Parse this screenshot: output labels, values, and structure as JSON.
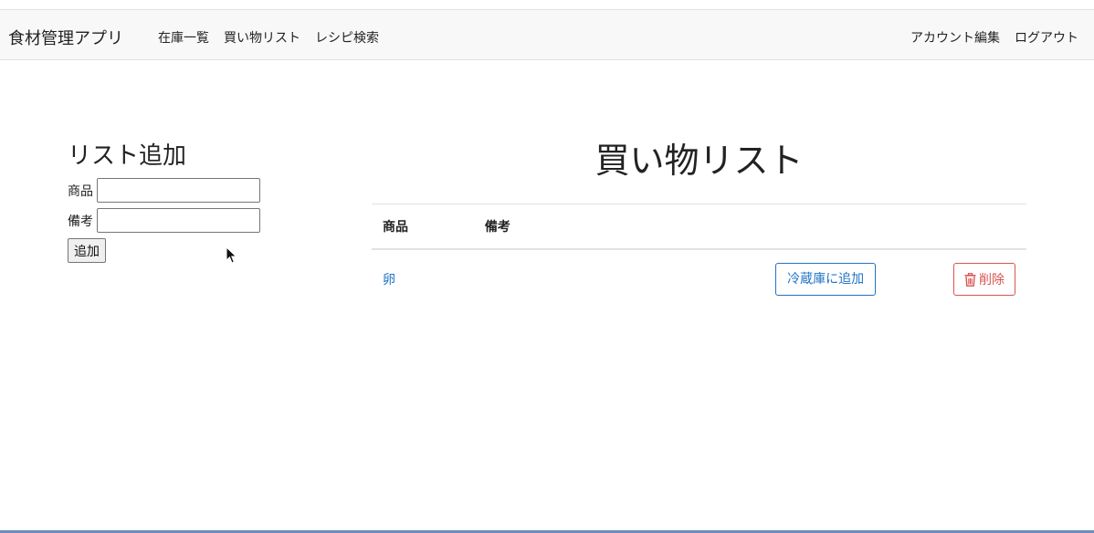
{
  "navbar": {
    "brand": "食材管理アプリ",
    "left_links": [
      "在庫一覧",
      "買い物リスト",
      "レシピ検索"
    ],
    "right_links": [
      "アカウント編集",
      "ログアウト"
    ]
  },
  "add_form": {
    "title": "リスト追加",
    "item_label": "商品",
    "item_value": "",
    "note_label": "備考",
    "note_value": "",
    "submit_label": "追加"
  },
  "shopping_list": {
    "title": "買い物リスト",
    "columns": [
      "商品",
      "備考"
    ],
    "rows": [
      {
        "item": "卵",
        "note": "",
        "add_to_fridge_label": "冷蔵庫に追加",
        "delete_label": "削除"
      }
    ]
  },
  "colors": {
    "primary": "#1f73c4",
    "danger": "#d9534f",
    "navbar_bg": "#f8f8f8"
  },
  "icons": {
    "delete": "trash-icon",
    "pointer": "mouse-cursor-icon"
  }
}
